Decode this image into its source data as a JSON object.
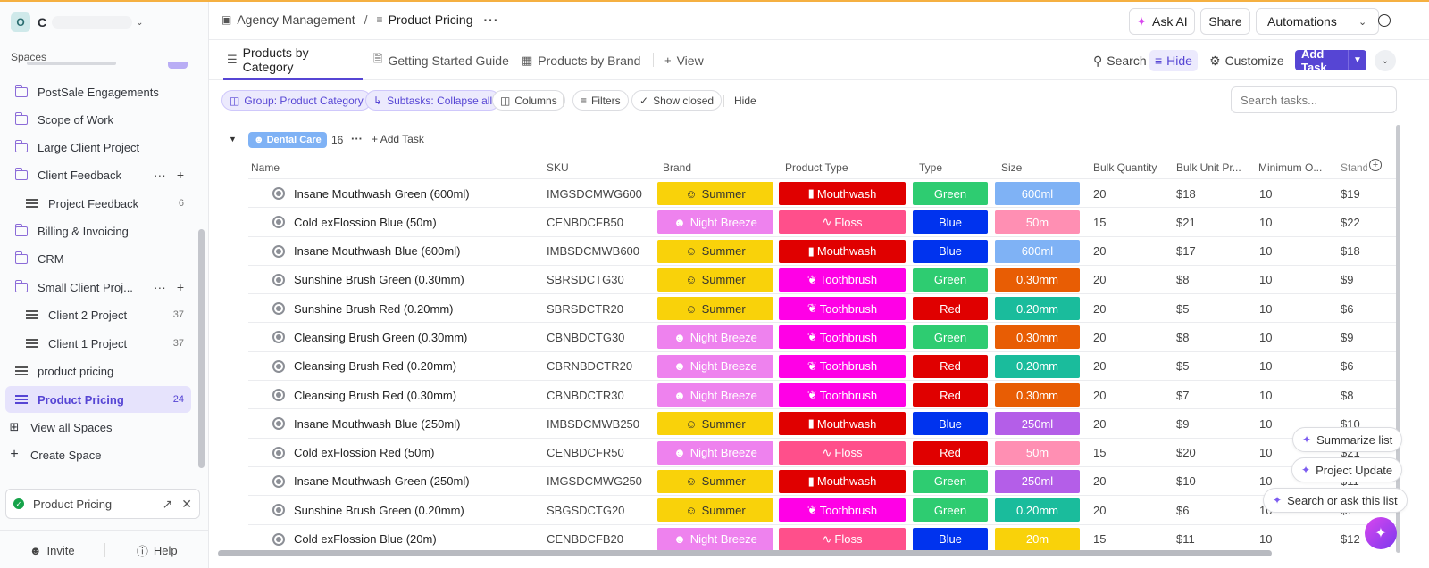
{
  "colors": {
    "accent": "#5645d4",
    "top_line": "#f5b041"
  },
  "workspace": {
    "initial": "O",
    "name": "C"
  },
  "sidebar": {
    "spaces_label": "Spaces",
    "items": [
      {
        "label": "PostSale Engagements",
        "icon": "folder-icon",
        "count": ""
      },
      {
        "label": "Scope of Work",
        "icon": "folder-icon",
        "count": ""
      },
      {
        "label": "Large Client Project",
        "icon": "folder-icon",
        "count": ""
      },
      {
        "label": "Client Feedback",
        "icon": "folder-open-icon",
        "count": ""
      },
      {
        "label": "Project Feedback",
        "icon": "list-icon",
        "count": "6"
      },
      {
        "label": "Billing & Invoicing",
        "icon": "folder-icon",
        "count": ""
      },
      {
        "label": "CRM",
        "icon": "folder-icon",
        "count": ""
      },
      {
        "label": "Small Client Proj...",
        "icon": "folder-open-icon",
        "count": ""
      },
      {
        "label": "Client 2 Project",
        "icon": "list-icon",
        "count": "37"
      },
      {
        "label": "Client 1 Project",
        "icon": "list-icon",
        "count": "37"
      },
      {
        "label": "product pricing",
        "icon": "list-icon",
        "count": ""
      },
      {
        "label": "Product Pricing",
        "icon": "list-icon",
        "count": "24"
      },
      {
        "label": "View all Spaces",
        "icon": "grid-icon",
        "count": ""
      },
      {
        "label": "Create Space",
        "icon": "plus-icon",
        "count": ""
      }
    ],
    "pinned": "Product Pricing",
    "invite": "Invite",
    "help": "Help"
  },
  "topbar": {
    "breadcrumb_1": "Agency Management",
    "separator": "/",
    "breadcrumb_2": "Product Pricing",
    "ask_ai": "Ask AI",
    "share": "Share",
    "automations": "Automations"
  },
  "views": {
    "tab_1": "Products by Category",
    "tab_2": "Getting Started Guide",
    "tab_3": "Products by Brand",
    "add_view": "View",
    "search": "Search",
    "hide": "Hide",
    "customize": "Customize",
    "add_task": "Add Task"
  },
  "filters": {
    "group": "Group: Product Category",
    "subtasks": "Subtasks: Collapse all",
    "columns": "Columns",
    "filters": "Filters",
    "show_closed": "Show closed",
    "hide": "Hide",
    "search_placeholder": "Search tasks..."
  },
  "group": {
    "name": "Dental Care",
    "count": "16",
    "add_task": "Add Task"
  },
  "columns": [
    "Name",
    "SKU",
    "Brand",
    "Product Type",
    "Type",
    "Size",
    "Bulk Quantity",
    "Bulk Unit Pr...",
    "Minimum O...",
    "Standa"
  ],
  "rows": [
    {
      "name": "Insane Mouthwash Green (600ml)",
      "sku": "IMGSDCMWG600",
      "brand": "Summer",
      "ptype": "Mouthwash",
      "type": "Green",
      "size": "600ml",
      "bulk_qty": "20",
      "bulk_unit": "$18",
      "min": "10",
      "std": "$19"
    },
    {
      "name": "Cold exFlossion Blue (50m)",
      "sku": "CENBDCFB50",
      "brand": "Night Breeze",
      "ptype": "Floss",
      "type": "Blue",
      "size": "50m",
      "bulk_qty": "15",
      "bulk_unit": "$21",
      "min": "10",
      "std": "$22"
    },
    {
      "name": "Insane Mouthwash Blue (600ml)",
      "sku": "IMBSDCMWB600",
      "brand": "Summer",
      "ptype": "Mouthwash",
      "type": "Blue",
      "size": "600ml",
      "bulk_qty": "20",
      "bulk_unit": "$17",
      "min": "10",
      "std": "$18"
    },
    {
      "name": "Sunshine Brush Green (0.30mm)",
      "sku": "SBRSDCTG30",
      "brand": "Summer",
      "ptype": "Toothbrush",
      "type": "Green",
      "size": "0.30mm",
      "bulk_qty": "20",
      "bulk_unit": "$8",
      "min": "10",
      "std": "$9"
    },
    {
      "name": "Sunshine Brush Red (0.20mm)",
      "sku": "SBRSDCTR20",
      "brand": "Summer",
      "ptype": "Toothbrush",
      "type": "Red",
      "size": "0.20mm",
      "bulk_qty": "20",
      "bulk_unit": "$5",
      "min": "10",
      "std": "$6"
    },
    {
      "name": "Cleansing Brush Green (0.30mm)",
      "sku": "CBNBDCTG30",
      "brand": "Night Breeze",
      "ptype": "Toothbrush",
      "type": "Green",
      "size": "0.30mm",
      "bulk_qty": "20",
      "bulk_unit": "$8",
      "min": "10",
      "std": "$9"
    },
    {
      "name": "Cleansing Brush Red (0.20mm)",
      "sku": "CBRNBDCTR20",
      "brand": "Night Breeze",
      "ptype": "Toothbrush",
      "type": "Red",
      "size": "0.20mm",
      "bulk_qty": "20",
      "bulk_unit": "$5",
      "min": "10",
      "std": "$6"
    },
    {
      "name": "Cleansing Brush Red (0.30mm)",
      "sku": "CBNBDCTR30",
      "brand": "Night Breeze",
      "ptype": "Toothbrush",
      "type": "Red",
      "size": "0.30mm",
      "bulk_qty": "20",
      "bulk_unit": "$7",
      "min": "10",
      "std": "$8"
    },
    {
      "name": "Insane Mouthwash Blue (250ml)",
      "sku": "IMBSDCMWB250",
      "brand": "Summer",
      "ptype": "Mouthwash",
      "type": "Blue",
      "size": "250ml",
      "bulk_qty": "20",
      "bulk_unit": "$9",
      "min": "10",
      "std": "$10"
    },
    {
      "name": "Cold exFlossion Red (50m)",
      "sku": "CENBDCFR50",
      "brand": "Night Breeze",
      "ptype": "Floss",
      "type": "Red",
      "size": "50m",
      "bulk_qty": "15",
      "bulk_unit": "$20",
      "min": "10",
      "std": "$21"
    },
    {
      "name": "Insane Mouthwash Green (250ml)",
      "sku": "IMGSDCMWG250",
      "brand": "Summer",
      "ptype": "Mouthwash",
      "type": "Green",
      "size": "250ml",
      "bulk_qty": "20",
      "bulk_unit": "$10",
      "min": "10",
      "std": "$11"
    },
    {
      "name": "Sunshine Brush Green (0.20mm)",
      "sku": "SBGSDCTG20",
      "brand": "Summer",
      "ptype": "Toothbrush",
      "type": "Green",
      "size": "0.20mm",
      "bulk_qty": "20",
      "bulk_unit": "$6",
      "min": "10",
      "std": "$7"
    },
    {
      "name": "Cold exFlossion Blue (20m)",
      "sku": "CENBDCFB20",
      "brand": "Night Breeze",
      "ptype": "Floss",
      "type": "Blue",
      "size": "20m",
      "bulk_qty": "15",
      "bulk_unit": "$11",
      "min": "10",
      "std": "$12"
    }
  ],
  "badge_colors": {
    "brand": {
      "Summer": "#f9d20a",
      "Night Breeze": "#ee82ee"
    },
    "ptype": {
      "Mouthwash": "#e00000",
      "Floss": "#ff4f8b",
      "Toothbrush": "#ff00e6"
    },
    "type": {
      "Green": "#2ecc71",
      "Blue": "#0033ee",
      "Red": "#e00000"
    },
    "size": {
      "600ml": "#7fb2f5",
      "50m": "#ff8fb3",
      "0.30mm": "#e85d04",
      "0.20mm": "#1abc9c",
      "250ml": "#b45ee8",
      "20m": "#f9d20a"
    }
  },
  "ai_actions": {
    "summarize": "Summarize list",
    "update": "Project Update",
    "ask": "Search or ask this list"
  }
}
